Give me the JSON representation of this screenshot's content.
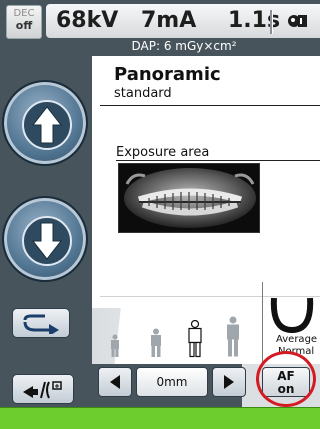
{
  "status_bar": {
    "dec_label": "DEC",
    "dec_value": "off",
    "kv": "68kV",
    "ma": "7mA",
    "time": "1.1s",
    "dap": "DAP: 6 mGy×cm²",
    "patient_icon": "patient-positioning-icon"
  },
  "program": {
    "title": "Panoramic",
    "subtitle": "standard",
    "exposure_label": "Exposure area",
    "preview_icon": "panoramic-xray-image"
  },
  "navigation": {
    "up_icon": "arrow-up-icon",
    "down_icon": "arrow-down-icon",
    "swap_icon": "curved-arrow-icon",
    "positioning_icon": "patient-entry-icon"
  },
  "patient_size": {
    "options": [
      "child",
      "small",
      "medium",
      "large"
    ],
    "selected": "medium"
  },
  "jaw": {
    "label_line1": "Average",
    "label_line2": "Normal",
    "icon": "jaw-shape-icon"
  },
  "controls": {
    "offset_value": "0mm",
    "af_label": "AF",
    "af_value": "on",
    "left_icon": "triangle-left-icon",
    "right_icon": "triangle-right-icon"
  },
  "colors": {
    "panel": "#47545c",
    "status_ok": "#6dcc2e",
    "highlight_ring": "#d41b23"
  }
}
